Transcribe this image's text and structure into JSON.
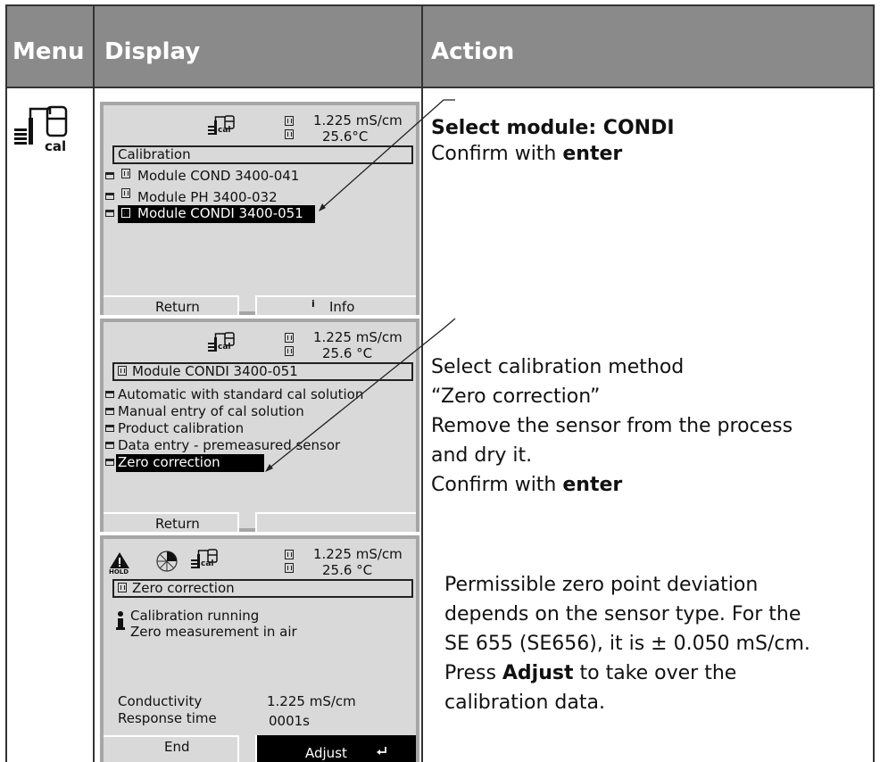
{
  "header": {
    "menu": "Menu",
    "display": "Display",
    "action": "Action"
  },
  "menu_icon": {
    "label": "cal"
  },
  "screen1": {
    "value1": "1.225 mS/cm",
    "value2": "25.6°C",
    "title": "Calibration",
    "items": [
      "Module COND 3400-041",
      "Module PH 3400-032",
      "Module CONDI 3400-051"
    ],
    "softkey_left": "Return",
    "softkey_right_icon": "i",
    "softkey_right": "Info"
  },
  "screen2": {
    "value1": "1.225 mS/cm",
    "value2": "25.6 °C",
    "title": "Module CONDI 3400-051",
    "items": [
      "Automatic with standard cal solution",
      "Manual entry of cal solution",
      "Product calibration",
      "Data entry - premeasured sensor",
      "Zero correction"
    ],
    "softkey_left": "Return",
    "softkey_right": ""
  },
  "screen3": {
    "value1": "1.225 mS/cm",
    "value2": "25.6 °C",
    "hold_label": "HOLD",
    "title": "Zero correction",
    "info_line1": "Calibration running",
    "info_line2": "Zero measurement in air",
    "row1_label": "Conductivity",
    "row1_value": "1.225 mS/cm",
    "row2_label": "Response time",
    "row2_value": "0001s",
    "softkey_left": "End",
    "softkey_right": "Adjust"
  },
  "screen_icon_label": "cal",
  "actions": {
    "a1_line1": "Select module: CONDI",
    "a1_line2_pre": "Confirm with ",
    "a1_line2_bold": "enter",
    "a2_line1": "Select calibration method",
    "a2_line2": "“Zero correction”",
    "a2_line3": "Remove the sensor from the process",
    "a2_line4": "and dry it.",
    "a2_line5_pre": "Confirm with ",
    "a2_line5_bold": "enter",
    "a3_line1": "Permissible zero point deviation",
    "a3_line2": "depends on the sensor type. For the",
    "a3_line3": "SE 655 (SE656), it is ± 0.050 mS/cm.",
    "a3_line4_pre": "Press ",
    "a3_line4_bold": "Adjust",
    "a3_line4_post": " to take over the",
    "a3_line5": "calibration data."
  }
}
